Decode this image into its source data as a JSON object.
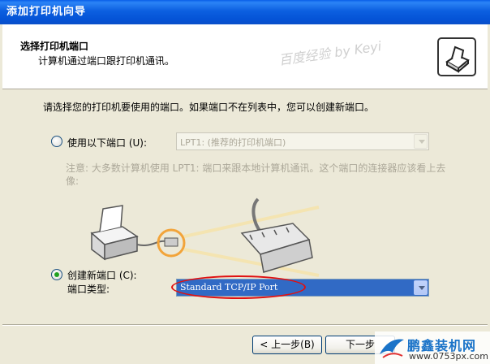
{
  "window": {
    "title": "添加打印机向导"
  },
  "header": {
    "title": "选择打印机端口",
    "subtitle": "计算机通过端口跟打印机通讯。",
    "watermark": "百度经验 by Keyi"
  },
  "body": {
    "prompt": "请选择您的打印机要使用的端口。如果端口不在列表中，您可以创建新端口。",
    "option_existing": {
      "label": "使用以下端口 (U):",
      "checked": false,
      "value": "LPT1: (推荐的打印机端口)",
      "enabled": false
    },
    "note": "注意: 大多数计算机使用 LPT1: 端口来跟本地计算机通讯。这个端口的连接器应该看上去像:",
    "option_new": {
      "label": "创建新端口 (C):",
      "checked": true
    },
    "port_type_label": "端口类型:",
    "port_type_value": "Standard TCP/IP Port"
  },
  "buttons": {
    "back": "< 上一步(B)",
    "next": "下一步"
  },
  "logo": {
    "main": "鹏鑫装机网",
    "sub": "www.0753px.com"
  },
  "colors": {
    "titlebar": "#0453d6",
    "selection": "#316ac5",
    "annotation": "#e01010",
    "radio_dot": "#21a121"
  }
}
